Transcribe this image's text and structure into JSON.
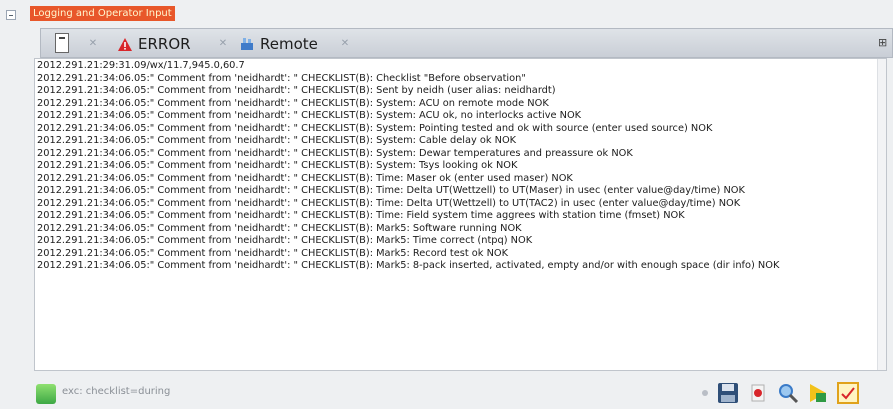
{
  "panel": {
    "title": "Logging and Operator Input"
  },
  "tabs": [
    {
      "label": ""
    },
    {
      "label": "ERROR"
    },
    {
      "label": "Remote"
    }
  ],
  "log": {
    "lines": [
      "2012.291.21:29:31.09/wx/11.7,945.0,60.7",
      "2012.291.21:34:06.05:\" Comment from 'neidhardt': \" CHECKLIST(B): Checklist \"Before observation\"",
      "2012.291.21:34:06.05:\" Comment from 'neidhardt': \" CHECKLIST(B): Sent by neidh (user alias: neidhardt)",
      "2012.291.21:34:06.05:\" Comment from 'neidhardt': \" CHECKLIST(B): System: ACU on remote mode NOK",
      "2012.291.21:34:06.05:\" Comment from 'neidhardt': \" CHECKLIST(B): System: ACU ok, no interlocks active NOK",
      "2012.291.21:34:06.05:\" Comment from 'neidhardt': \" CHECKLIST(B): System: Pointing tested and ok with source (enter used source) NOK",
      "2012.291.21:34:06.05:\" Comment from 'neidhardt': \" CHECKLIST(B): System: Cable delay ok NOK",
      "2012.291.21:34:06.05:\" Comment from 'neidhardt': \" CHECKLIST(B): System: Dewar temperatures and preassure ok NOK",
      "2012.291.21:34:06.05:\" Comment from 'neidhardt': \" CHECKLIST(B): System: Tsys looking ok NOK",
      "2012.291.21:34:06.05:\" Comment from 'neidhardt': \" CHECKLIST(B): Time: Maser ok (enter used maser) NOK",
      "2012.291.21:34:06.05:\" Comment from 'neidhardt': \" CHECKLIST(B): Time: Delta UT(Wettzell) to UT(Maser) in usec (enter value@day/time) NOK",
      "2012.291.21:34:06.05:\" Comment from 'neidhardt': \" CHECKLIST(B): Time: Delta UT(Wettzell) to UT(TAC2) in usec (enter value@day/time) NOK",
      "2012.291.21:34:06.05:\" Comment from 'neidhardt': \" CHECKLIST(B): Time: Field system time aggrees with station time (fmset) NOK",
      "2012.291.21:34:06.05:\" Comment from 'neidhardt': \" CHECKLIST(B): Mark5: Software running NOK",
      "2012.291.21:34:06.05:\" Comment from 'neidhardt': \" CHECKLIST(B): Mark5: Time correct (ntpq) NOK",
      "2012.291.21:34:06.05:\" Comment from 'neidhardt': \" CHECKLIST(B): Mark5: Record test ok NOK",
      "2012.291.21:34:06.05:\" Comment from 'neidhardt': \" CHECKLIST(B): Mark5: 8-pack inserted, activated, empty and/or with enough space (dir info) NOK"
    ]
  },
  "status": {
    "text": "exc: checklist=during"
  },
  "colors": {
    "title_bg": "#e8572a",
    "error_icon": "#d8262b",
    "status_ok": "#4dbb4f"
  },
  "icons": [
    "document-icon",
    "warning-icon",
    "remote-icon",
    "close-icon",
    "menu-icon",
    "save-icon",
    "delete-icon",
    "search-icon",
    "run-icon",
    "checklist-icon"
  ]
}
